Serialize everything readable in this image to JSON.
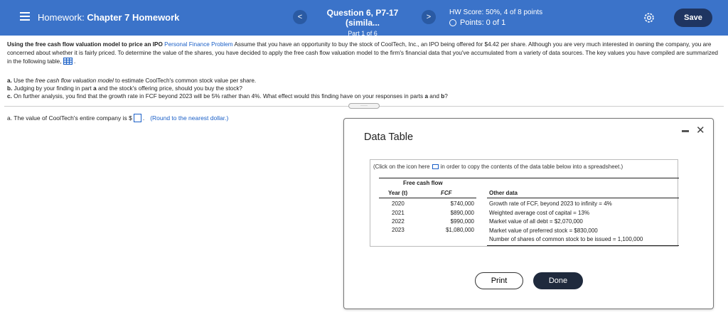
{
  "header": {
    "title_prefix": "Homework:",
    "title_main": "Chapter 7 Homework",
    "question_title": "Question 6, P7-17 (simila...",
    "question_part": "Part 1 of 6",
    "prev_label": "<",
    "next_label": ">",
    "score": "HW Score: 50%, 4 of 8 points",
    "points": "Points: 0 of 1",
    "save_label": "Save"
  },
  "problem": {
    "heading": "Using the free cash flow valuation model to price an IPO",
    "link": "Personal Finance Problem",
    "body": "Assume that you have an opportunity to buy the stock of CoolTech, Inc., an IPO being offered for $4.42 per share. Although you are very much interested in owning the company, you are concerned about whether it is fairly priced. To determine the value of the shares, you have decided to apply the free cash flow valuation model to the firm's financial data that you've accumulated from a variety of data sources. The key values you have compiled are summarized in the following table,",
    "end_punct": ".",
    "part_a_prefix": "a.",
    "part_a_pre": "Use the",
    "part_a_italic": "free cash flow valuation model",
    "part_a_post": "to estimate CoolTech's common stock value per share.",
    "part_b_prefix": "b.",
    "part_b_text_1": "Judging by your finding in part",
    "part_b_bold": "a",
    "part_b_text_2": "and the stock's offering price, should you buy the stock?",
    "part_c_prefix": "c.",
    "part_c_text": "On further analysis, you find that the growth rate in FCF beyond 2023 will be 5% rather than 4%. What effect would this finding have on your responses in parts",
    "part_c_bold_a": "a",
    "part_c_and": "and",
    "part_c_bold_b": "b",
    "part_c_end": "?"
  },
  "answer": {
    "prompt": "a. The value of CoolTech's entire company is $",
    "after": ".",
    "hint": "(Round to the nearest dollar.)",
    "value": ""
  },
  "dialog": {
    "title": "Data Table",
    "copy_pre": "(Click on the icon here",
    "copy_post": "in order to copy the contents of the data table below into a spreadsheet.)",
    "fcf_header": "Free cash flow",
    "col_year": "Year (t)",
    "col_fcf": "FCF",
    "col_other": "Other data",
    "rows": [
      {
        "year": "2020",
        "fcf": "$740,000"
      },
      {
        "year": "2021",
        "fcf": "$890,000"
      },
      {
        "year": "2022",
        "fcf": "$990,000"
      },
      {
        "year": "2023",
        "fcf": "$1,080,000"
      }
    ],
    "other": [
      "Growth rate of FCF, beyond 2023 to infinity = 4%",
      "Weighted average cost of capital = 13%",
      "Market value of all debt = $2,070,000",
      "Market value of preferred stock = $830,000",
      "Number of shares of common stock to be issued = 1,100,000"
    ],
    "print_label": "Print",
    "done_label": "Done",
    "close_label": "✕"
  }
}
